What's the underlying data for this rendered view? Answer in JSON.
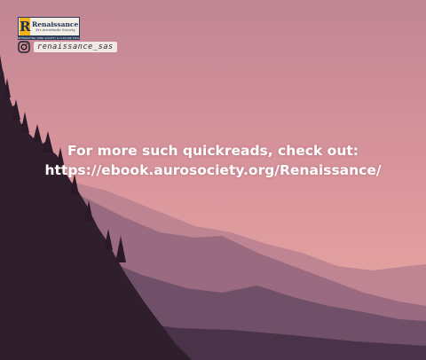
{
  "brand": {
    "name": "Renaissance",
    "tagline": "Sri Aurobindo Society",
    "strip": "INTEGRATING MIND SOCIETY & CULTURE WELL",
    "logo_letter": "R"
  },
  "social": {
    "icon": "instagram-icon",
    "handle": "renaissance_sas"
  },
  "message": {
    "line1": "For more such quickreads, check out:",
    "line2": "https://ebook.aurosociety.org/Renaissance/"
  },
  "colors": {
    "sky_top": "#c48a96",
    "sky_bottom": "#e9a79f",
    "text": "#ffffff"
  }
}
